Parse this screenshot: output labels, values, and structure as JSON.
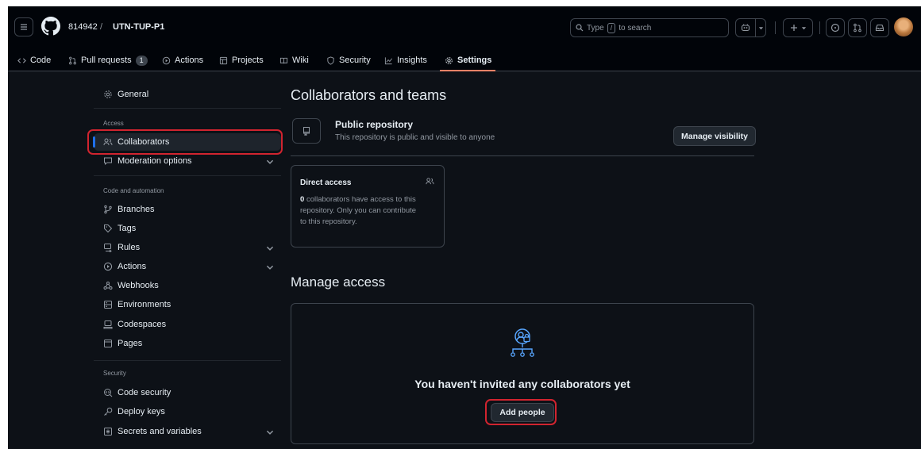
{
  "header": {
    "owner": "814942",
    "separator": "/",
    "repo": "UTN-TUP-P1",
    "search_prefix": "Type",
    "search_key": "/",
    "search_suffix": "to search"
  },
  "tabs": [
    {
      "label": "Code",
      "icon": "code-icon"
    },
    {
      "label": "Pull requests",
      "icon": "pull-request-icon",
      "count": "1"
    },
    {
      "label": "Actions",
      "icon": "play-circle-icon"
    },
    {
      "label": "Projects",
      "icon": "table-icon"
    },
    {
      "label": "Wiki",
      "icon": "book-icon"
    },
    {
      "label": "Security",
      "icon": "shield-icon"
    },
    {
      "label": "Insights",
      "icon": "graph-icon"
    },
    {
      "label": "Settings",
      "icon": "gear-icon",
      "active": true
    }
  ],
  "sidebar": {
    "general": "General",
    "access_heading": "Access",
    "collaborators": "Collaborators",
    "moderation": "Moderation options",
    "code_heading": "Code and automation",
    "branches": "Branches",
    "tags": "Tags",
    "rules": "Rules",
    "actions": "Actions",
    "webhooks": "Webhooks",
    "environments": "Environments",
    "codespaces": "Codespaces",
    "pages": "Pages",
    "security_heading": "Security",
    "code_security": "Code security",
    "deploy_keys": "Deploy keys",
    "secrets": "Secrets and variables"
  },
  "main": {
    "title": "Collaborators and teams",
    "public_title": "Public repository",
    "public_subtitle": "This repository is public and visible to anyone",
    "manage_visibility": "Manage visibility",
    "direct_access_title": "Direct access",
    "direct_access_count": "0",
    "direct_access_line1": "collaborators have access to this",
    "direct_access_line2": "repository. Only you can contribute",
    "direct_access_line3": "to this repository.",
    "manage_access_title": "Manage access",
    "empty_message": "You haven't invited any collaborators yet",
    "add_people": "Add people"
  },
  "colors": {
    "background": "#0d1117",
    "accent_blue": "#1f6feb",
    "tab_underline": "#f78166",
    "highlight_red": "#d1242f"
  }
}
